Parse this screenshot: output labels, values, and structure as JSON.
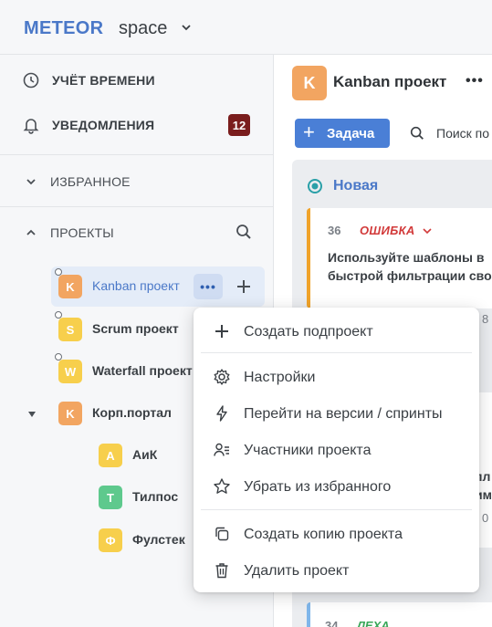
{
  "header": {
    "logo": "METEOR",
    "workspace": "space"
  },
  "sidebar": {
    "time_tracking": "УЧЁТ ВРЕМЕНИ",
    "notifications": "УВЕДОМЛЕНИЯ",
    "notifications_count": "12",
    "favorites": "ИЗБРАННОЕ",
    "projects": "ПРОЕКТЫ",
    "project_list": [
      {
        "letter": "K",
        "name": "Kanban проект",
        "color": "#f2a561"
      },
      {
        "letter": "S",
        "name": "Scrum проект",
        "color": "#f7cf4c"
      },
      {
        "letter": "W",
        "name": "Waterfall проект",
        "color": "#f7cf4c"
      },
      {
        "letter": "K",
        "name": "Корп.портал",
        "color": "#f2a561"
      },
      {
        "letter": "А",
        "name": "АиК",
        "color": "#f7cf4c"
      },
      {
        "letter": "Т",
        "name": "Тилпос",
        "color": "#5ec98d"
      },
      {
        "letter": "Ф",
        "name": "Фулстек",
        "color": "#f7cf4c"
      }
    ]
  },
  "main": {
    "avatar_letter": "K",
    "title": "Kanban проект",
    "more": "•••",
    "task_button": "Задача",
    "task_plus": "+",
    "search_placeholder": "Поиск по",
    "column_title": "Новая",
    "card1": {
      "number": "36",
      "type": "ОШИБКА",
      "text_line1": "Используйте шаблоны в",
      "text_line2": "быстрой фильтрации сво",
      "meta": "8"
    },
    "card2": {
      "text_line1": "пл",
      "text_line2": "им",
      "meta": "0"
    },
    "card3": {
      "number": "34",
      "type": "ЛЕХА"
    }
  },
  "menu": {
    "create_subproject": "Создать подпроект",
    "settings": "Настройки",
    "go_to_versions": "Перейти на версии / спринты",
    "participants": "Участники проекта",
    "remove_favorite": "Убрать из избранного",
    "copy_project": "Создать копию проекта",
    "delete_project": "Удалить проект"
  }
}
